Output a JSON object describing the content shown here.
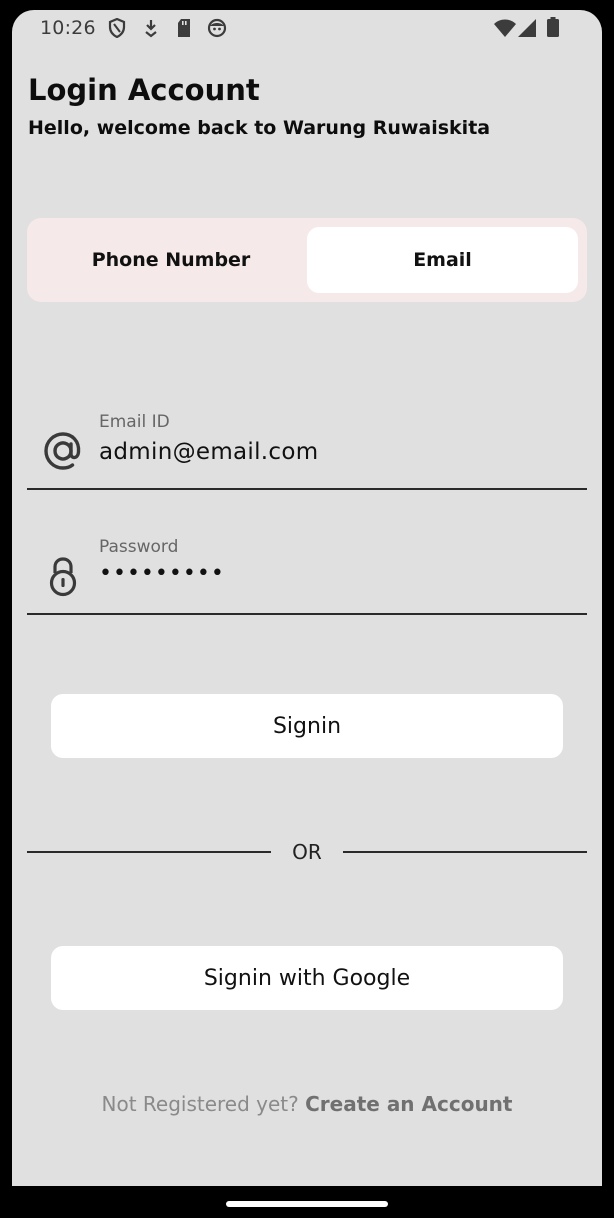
{
  "status_bar": {
    "time": "10:26",
    "icons_left": [
      "shield-icon",
      "download-icon",
      "sd-card-icon",
      "face-icon"
    ],
    "icons_right": [
      "wifi-icon",
      "signal-icon",
      "battery-icon"
    ]
  },
  "header": {
    "title": "Login Account",
    "subtitle": "Hello, welcome back to Warung Ruwaiskita"
  },
  "tabs": [
    {
      "label": "Phone Number",
      "selected": false
    },
    {
      "label": "Email",
      "selected": true
    }
  ],
  "form": {
    "email": {
      "label": "Email ID",
      "value": "admin@email.com",
      "icon": "at-sign-icon"
    },
    "password": {
      "label": "Password",
      "value": "•••••••••",
      "icon": "lock-icon"
    }
  },
  "buttons": {
    "signin": "Signin",
    "google": "Signin with Google"
  },
  "divider_text": "OR",
  "footer": {
    "prompt": "Not Registered yet?",
    "link": "Create an Account"
  },
  "colors": {
    "background": "#e0e0e0",
    "tab_background": "#f5e9e9",
    "surface": "#ffffff"
  }
}
